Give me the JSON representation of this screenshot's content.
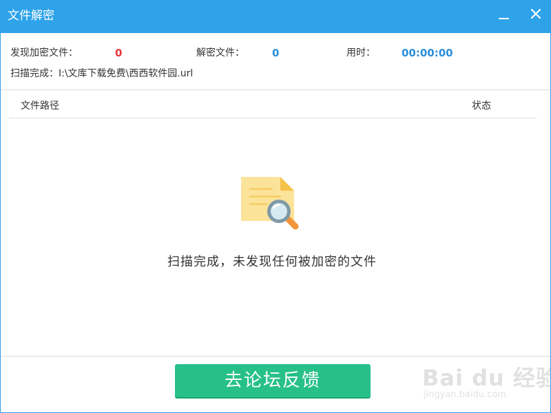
{
  "window": {
    "title": "文件解密"
  },
  "stats": {
    "found_label": "发现加密文件：",
    "found_value": "0",
    "decrypted_label": "解密文件：",
    "decrypted_value": "0",
    "time_label": "用时：",
    "time_value": "00:00:00"
  },
  "scan": {
    "status_text": "扫描完成：I:\\文库下载免费\\西西软件园.url"
  },
  "list": {
    "columns": [
      "文件路径",
      "状态"
    ],
    "empty_message": "扫描完成，未发现任何被加密的文件"
  },
  "actions": {
    "feedback_label": "去论坛反馈"
  },
  "watermark": {
    "logo_text": "Bai du 经验",
    "url_text": "jingyan.baidu.com"
  },
  "colors": {
    "titlebar": "#2ea3ea",
    "found_value": "#e8363b",
    "accent_value": "#2a8fdb",
    "feedback_button": "#27c08a"
  },
  "icons": {
    "empty_state": "document-search-icon",
    "minimize": "minimize-icon",
    "close": "close-icon"
  }
}
